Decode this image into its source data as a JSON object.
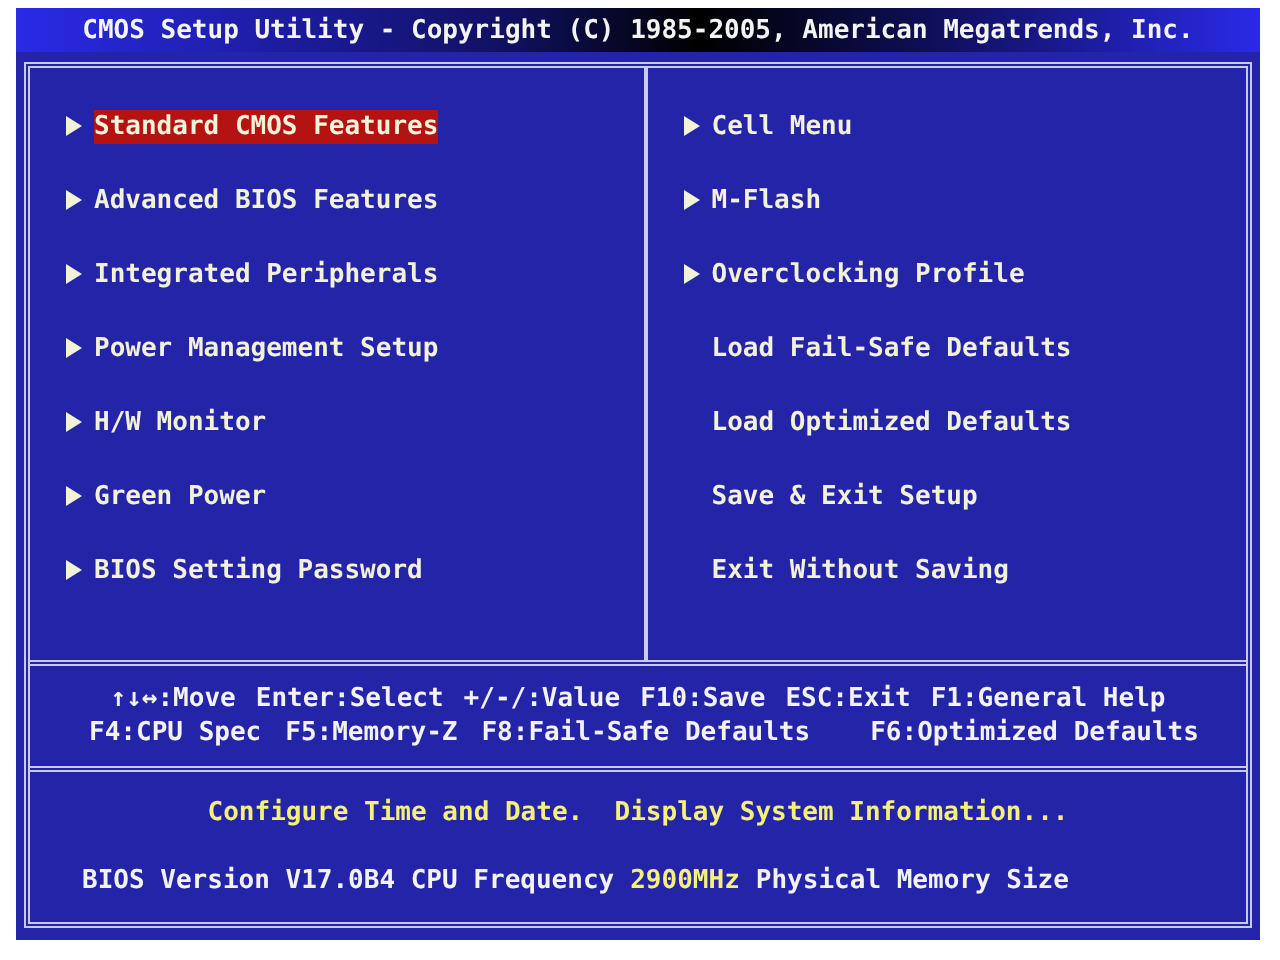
{
  "title": "CMOS Setup Utility - Copyright (C) 1985-2005, American Megatrends, Inc.",
  "left_menu": [
    {
      "label": "Standard CMOS Features",
      "submenu": true,
      "selected": true
    },
    {
      "label": "Advanced BIOS Features",
      "submenu": true,
      "selected": false
    },
    {
      "label": "Integrated Peripherals",
      "submenu": true,
      "selected": false
    },
    {
      "label": "Power Management Setup",
      "submenu": true,
      "selected": false
    },
    {
      "label": "H/W Monitor",
      "submenu": true,
      "selected": false
    },
    {
      "label": "Green Power",
      "submenu": true,
      "selected": false
    },
    {
      "label": "BIOS Setting Password",
      "submenu": true,
      "selected": false
    }
  ],
  "right_menu": [
    {
      "label": "Cell Menu",
      "submenu": true,
      "selected": false
    },
    {
      "label": "M-Flash",
      "submenu": true,
      "selected": false
    },
    {
      "label": "Overclocking Profile",
      "submenu": true,
      "selected": false
    },
    {
      "label": "Load Fail-Safe Defaults",
      "submenu": false,
      "selected": false
    },
    {
      "label": "Load Optimized Defaults",
      "submenu": false,
      "selected": false
    },
    {
      "label": "Save & Exit Setup",
      "submenu": false,
      "selected": false
    },
    {
      "label": "Exit Without Saving",
      "submenu": false,
      "selected": false
    }
  ],
  "key_help": [
    [
      "↑↓↔:Move",
      "Enter:Select",
      "+/-/:Value",
      "F10:Save",
      "ESC:Exit",
      "F1:General Help"
    ],
    [
      "F4:CPU Spec",
      "F5:Memory-Z",
      "F8:Fail-Safe Defaults",
      "F6:Optimized Defaults"
    ]
  ],
  "description": "Configure Time and Date.  Display System Information...",
  "info_line": [
    {
      "text": "BIOS Version V17.0B4 CPU Frequency",
      "highlight": false
    },
    {
      "text": "2900MHz",
      "highlight": true
    },
    {
      "text": "Physical Memory Size",
      "highlight": false
    }
  ]
}
